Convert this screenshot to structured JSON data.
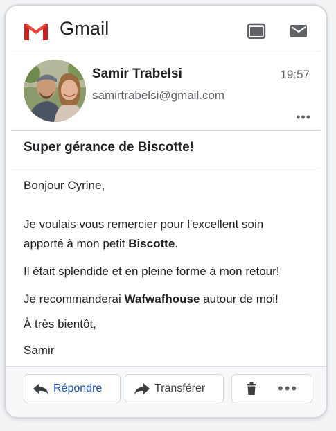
{
  "app": {
    "title": "Gmail",
    "icons": [
      "gmail-logo",
      "window-icon",
      "mail-icon"
    ]
  },
  "message": {
    "sender_name": "Samir Trabelsi",
    "sender_email": "samirtrabelsi@gmail.com",
    "time": "19:57",
    "more_label": "•••",
    "subject": "Super gérance de Biscotte!",
    "body": {
      "greeting": "Bonjour Cyrine,",
      "line1": "Je voulais vous remercier pour l'excellent soin",
      "line2_pre": "apporté à mon petit ",
      "line2_bold": "Biscotte",
      "line2_post": ".",
      "line3": "Il était splendide et en pleine forme à mon retour!",
      "line4_pre": "Je recommanderai ",
      "line4_bold": "Wafwafhouse",
      "line4_post": " autour de moi!",
      "closing": "À très bientôt,",
      "signature": "Samir"
    }
  },
  "actions": {
    "reply_label": "Répondre",
    "forward_label": "Transférer",
    "more_label": "•••"
  },
  "colors": {
    "gmail_red": "#ea4335",
    "reply_blue": "#1a55b8",
    "icon_gray": "#5f6368"
  }
}
